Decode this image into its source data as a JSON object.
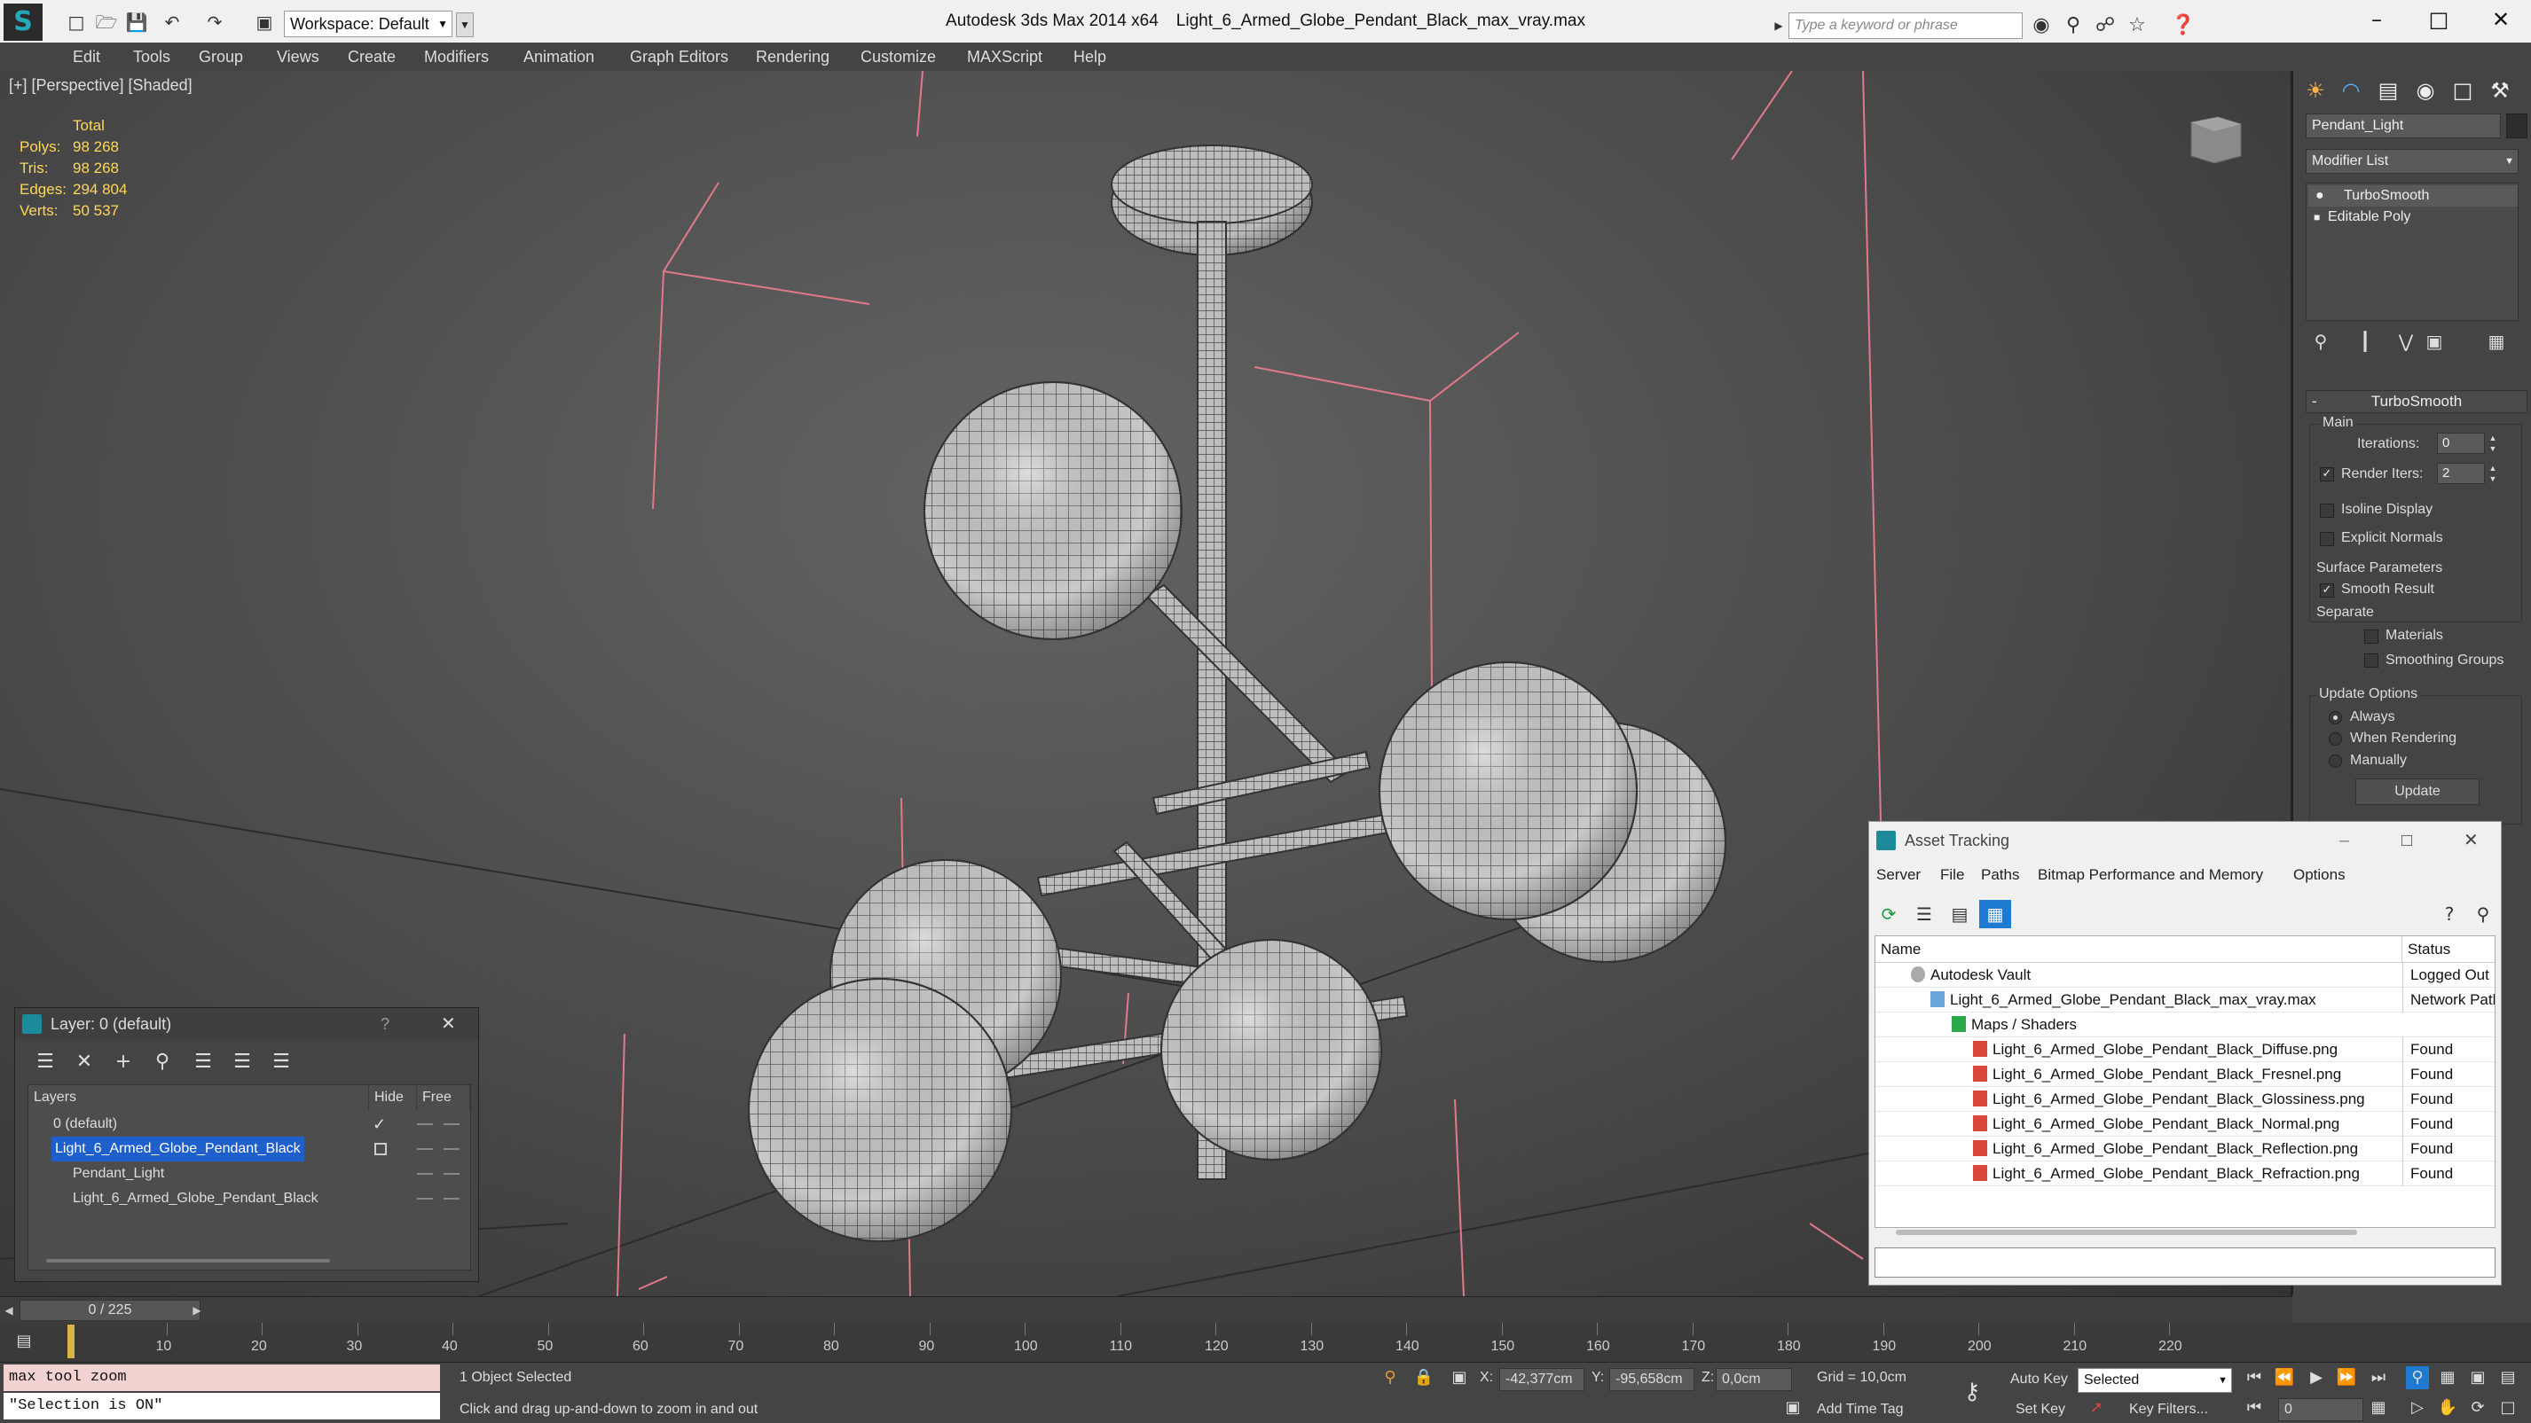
{
  "titlebar": {
    "app": "Autodesk 3ds Max  2014 x64",
    "file": "Light_6_Armed_Globe_Pendant_Black_max_vray.max",
    "workspace": "Workspace: Default",
    "search_placeholder": "Type a keyword or phrase"
  },
  "menu": [
    "Edit",
    "Tools",
    "Group",
    "Views",
    "Create",
    "Modifiers",
    "Animation",
    "Graph Editors",
    "Rendering",
    "Customize",
    "MAXScript",
    "Help"
  ],
  "viewport": {
    "label": "[+] [Perspective] [Shaded]",
    "stats": {
      "total_label": "Total",
      "rows": [
        {
          "k": "Polys:",
          "v": "98 268"
        },
        {
          "k": "Tris:",
          "v": "98 268"
        },
        {
          "k": "Edges:",
          "v": "294 804"
        },
        {
          "k": "Verts:",
          "v": "50 537"
        }
      ]
    }
  },
  "command_panel": {
    "object_name": "Pendant_Light",
    "modifier_list": "Modifier List",
    "stack": [
      "TurboSmooth",
      "Editable Poly"
    ],
    "rollout_title": "TurboSmooth",
    "main_label": "Main",
    "iterations_label": "Iterations:",
    "iterations_value": "0",
    "render_iters_label": "Render Iters:",
    "render_iters_value": "2",
    "isoline": "Isoline Display",
    "explicit_normals": "Explicit Normals",
    "surface_params": "Surface Parameters",
    "smooth_result": "Smooth Result",
    "separate": "Separate",
    "materials": "Materials",
    "smoothing_groups": "Smoothing Groups",
    "update_options": "Update Options",
    "always": "Always",
    "when_rendering": "When Rendering",
    "manually": "Manually",
    "update_button": "Update"
  },
  "layer_window": {
    "title": "Layer: 0 (default)",
    "help": "?",
    "col_layers": "Layers",
    "col_hide": "Hide",
    "col_freeze": "Free",
    "rows": [
      {
        "label": "0 (default)"
      },
      {
        "label": "Light_6_Armed_Globe_Pendant_Black"
      },
      {
        "label": "Pendant_Light"
      },
      {
        "label": "Light_6_Armed_Globe_Pendant_Black"
      }
    ]
  },
  "asset_window": {
    "title": "Asset Tracking",
    "menu": [
      "Server",
      "File",
      "Paths",
      "Bitmap Performance and Memory",
      "Options"
    ],
    "col_name": "Name",
    "col_status": "Status",
    "rows": [
      {
        "name": "Autodesk Vault",
        "status": "Logged Out ..."
      },
      {
        "name": "Light_6_Armed_Globe_Pendant_Black_max_vray.max",
        "status": "Network Path"
      },
      {
        "name": "Maps / Shaders",
        "status": ""
      },
      {
        "name": "Light_6_Armed_Globe_Pendant_Black_Diffuse.png",
        "status": "Found"
      },
      {
        "name": "Light_6_Armed_Globe_Pendant_Black_Fresnel.png",
        "status": "Found"
      },
      {
        "name": "Light_6_Armed_Globe_Pendant_Black_Glossiness.png",
        "status": "Found"
      },
      {
        "name": "Light_6_Armed_Globe_Pendant_Black_Normal.png",
        "status": "Found"
      },
      {
        "name": "Light_6_Armed_Globe_Pendant_Black_Reflection.png",
        "status": "Found"
      },
      {
        "name": "Light_6_Armed_Globe_Pendant_Black_Refraction.png",
        "status": "Found"
      }
    ]
  },
  "timeline": {
    "slider": "0 / 225",
    "ticks": [
      "10",
      "20",
      "30",
      "40",
      "50",
      "60",
      "70",
      "80",
      "90",
      "100",
      "110",
      "120",
      "130",
      "140",
      "150",
      "160",
      "170",
      "180",
      "190",
      "200",
      "210",
      "220"
    ]
  },
  "status": {
    "maxscript_line1": "max tool zoom",
    "maxscript_line2": "\"Selection is ON\"",
    "selected": "1 Object Selected",
    "prompt": "Click and drag up-and-down to zoom in and out",
    "x_label": "X:",
    "x_value": "-42,377cm",
    "y_label": "Y:",
    "y_value": "-95,658cm",
    "z_label": "Z:",
    "z_value": "0,0cm",
    "grid": "Grid = 10,0cm",
    "add_time_tag": "Add Time Tag",
    "auto_key": "Auto Key",
    "set_key": "Set Key",
    "selection_set": "Selected",
    "key_filters": "Key Filters...",
    "frame": "0"
  }
}
